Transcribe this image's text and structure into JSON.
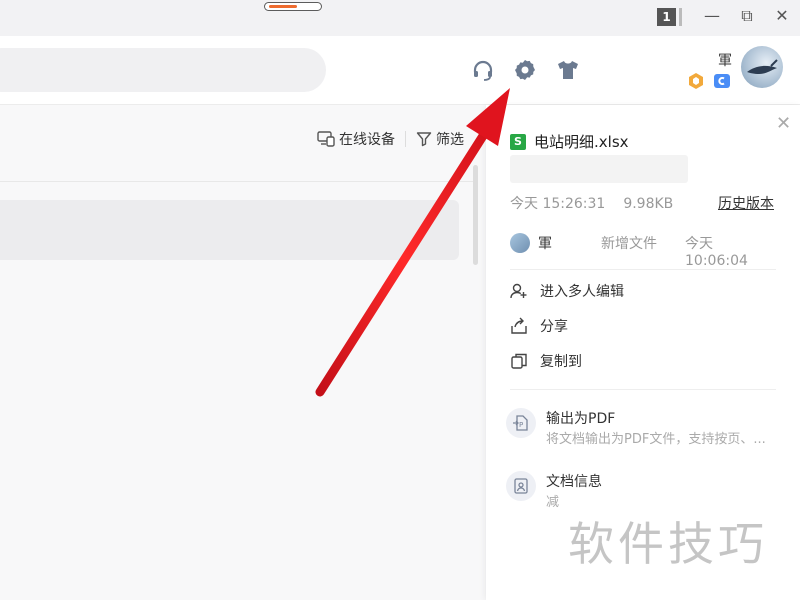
{
  "titlebar": {
    "window_count": "1",
    "minimize": "—",
    "restore": "⧉",
    "close": "✕"
  },
  "toolbar": {
    "icons": [
      "headset-icon",
      "gear-icon",
      "tshirt-icon"
    ],
    "user_name": "軍"
  },
  "filters": {
    "online_devices": "在线设备",
    "filter": "筛选"
  },
  "panel": {
    "file_name": "电站明细.xlsx",
    "meta_time": "今天 15:26:31",
    "meta_size": "9.98KB",
    "history": "历史版本",
    "author": "軍",
    "author_action": "新增文件",
    "author_time": "今天 10:06:04",
    "actions": [
      {
        "label": "进入多人编辑",
        "icon": "add-user-icon"
      },
      {
        "label": "分享",
        "icon": "share-icon"
      },
      {
        "label": "复制到",
        "icon": "copy-icon"
      }
    ],
    "export_pdf": {
      "title": "输出为PDF",
      "subtitle": "将文档输出为PDF文件，支持按页、..."
    },
    "doc_info": {
      "title": "文档信息",
      "subtitle": "减"
    }
  },
  "watermark": "软件技巧",
  "colors": {
    "accent_orange": "#ee6b2f",
    "file_green": "#28a745",
    "arrow_red": "#e0141e"
  }
}
